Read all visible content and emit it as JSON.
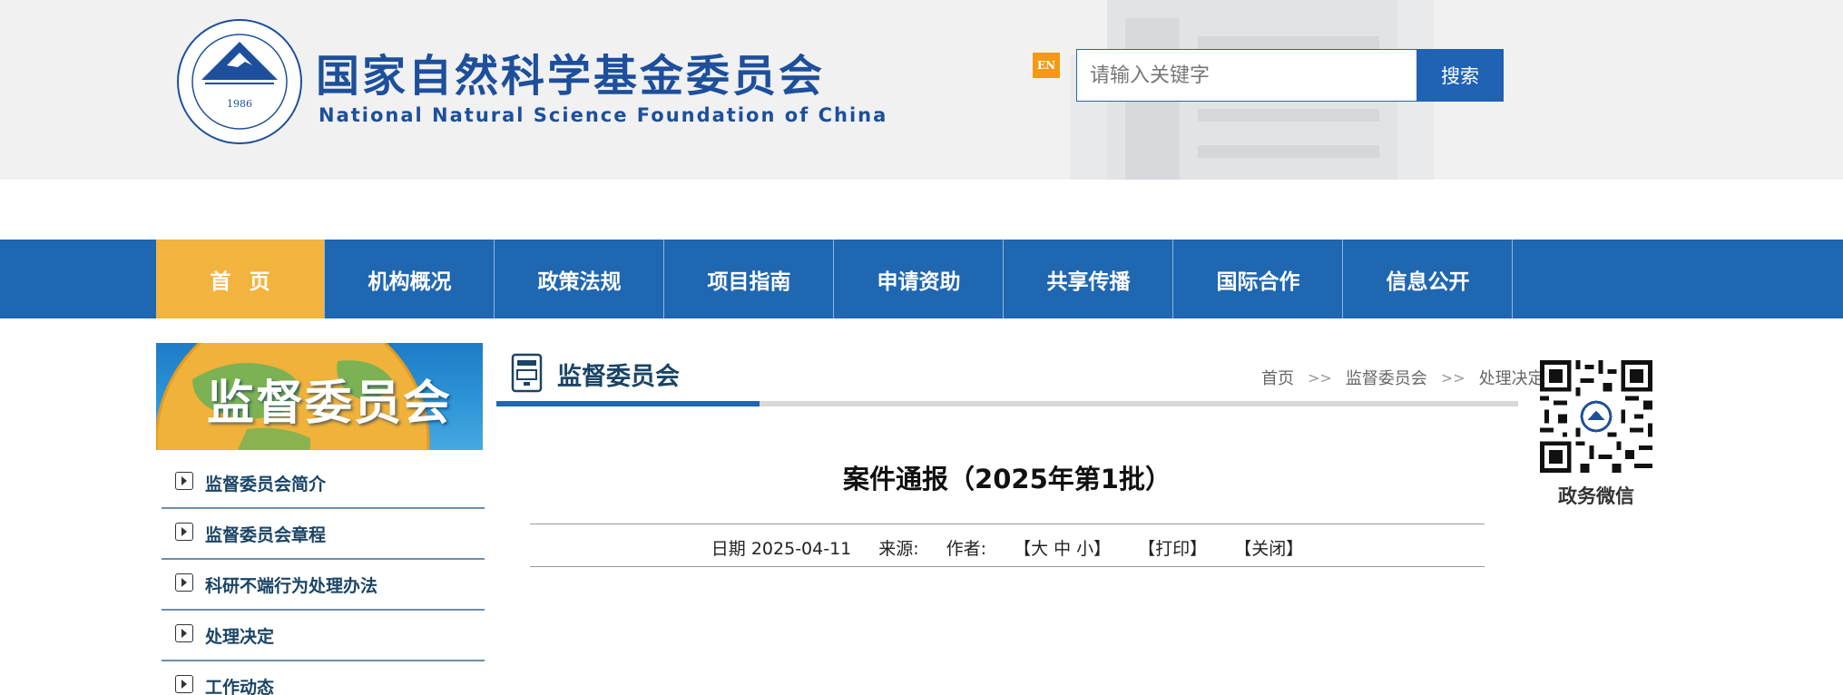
{
  "header": {
    "logo_cn": "国家自然科学基金委员会",
    "logo_en": "National Natural Science Foundation of China",
    "seal_year": "1986",
    "lang_badge": "EN",
    "search_placeholder": "请输入关键字",
    "search_button": "搜索"
  },
  "nav": {
    "items": [
      {
        "label": "首页"
      },
      {
        "label": "机构概况"
      },
      {
        "label": "政策法规"
      },
      {
        "label": "项目指南"
      },
      {
        "label": "申请资助"
      },
      {
        "label": "共享传播"
      },
      {
        "label": "国际合作"
      },
      {
        "label": "信息公开"
      }
    ]
  },
  "sidebar": {
    "banner_text": "监督委员会",
    "items": [
      {
        "label": "监督委员会简介"
      },
      {
        "label": "监督委员会章程"
      },
      {
        "label": "科研不端行为处理办法"
      },
      {
        "label": "处理决定"
      },
      {
        "label": "工作动态"
      }
    ]
  },
  "main": {
    "section_title": "监督委员会",
    "breadcrumb": [
      "首页",
      "监督委员会",
      "处理决定"
    ],
    "breadcrumb_sep": ">>",
    "article_title": "案件通报（2025年第1批）",
    "meta": {
      "date": "日期 2025-04-11",
      "source": "来源:",
      "author": "作者:",
      "font_size": "【大 中 小】",
      "print": "【打印】",
      "close": "【关闭】"
    }
  },
  "qr": {
    "caption": "政务微信"
  },
  "colors": {
    "nav_bg": "#1f67b1",
    "nav_active": "#f2b43f",
    "brand_blue": "#1d4f9c",
    "badge_orange": "#f29b12"
  }
}
